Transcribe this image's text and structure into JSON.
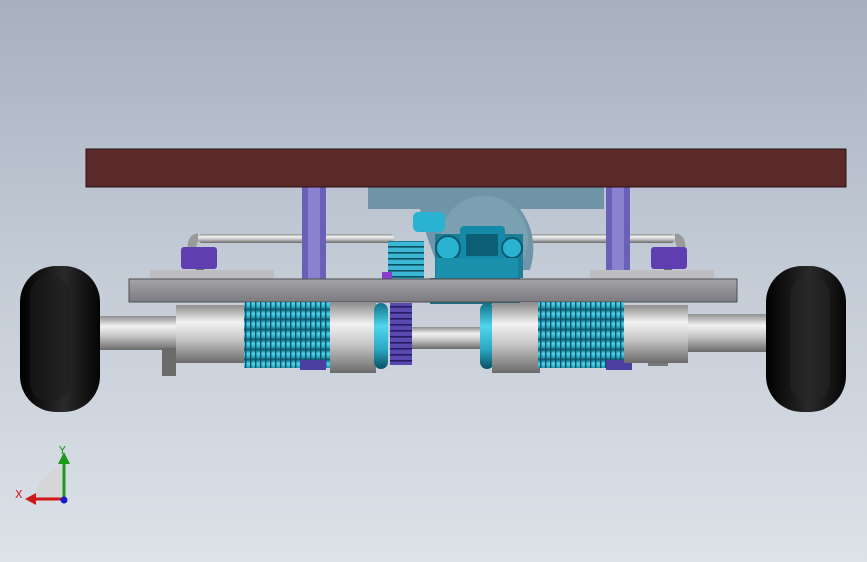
{
  "colors": {
    "background_top": "#a6b0bf",
    "background_bottom": "#dde2e8",
    "deck": "#5a2a2a",
    "frame": "#8f8f96",
    "bracket": "#6a60b8",
    "motor_cyan": "#2aa9c4",
    "wheel": "#0c0c0c",
    "axle": "#c9c9c9",
    "housing": "#6e97a8"
  },
  "triad": {
    "x_label": "X",
    "y_label": "Y",
    "x_color": "#d01818",
    "y_color": "#1c9a1c",
    "z_color": "#1818d0"
  },
  "icons": [
    "coordinate-triad-icon"
  ]
}
